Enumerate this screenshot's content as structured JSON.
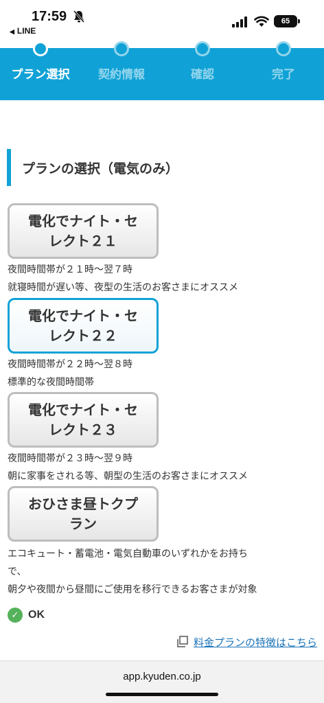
{
  "status_bar": {
    "time": "17:59",
    "back_label": "LINE",
    "battery": "65"
  },
  "progress": {
    "steps": [
      {
        "label": "プラン選択",
        "active": true
      },
      {
        "label": "契約情報",
        "active": false
      },
      {
        "label": "確認",
        "active": false
      },
      {
        "label": "完了",
        "active": false
      }
    ]
  },
  "section": {
    "title": "プランの選択（電気のみ）"
  },
  "plans": [
    {
      "name_line1": "電化でナイト・セ",
      "name_line2": "レクト２１",
      "desc_line1": "夜間時間帯が２１時〜翌７時",
      "desc_line2": "就寝時間が遅い等、夜型の生活のお客さまにオススメ",
      "selected": false
    },
    {
      "name_line1": "電化でナイト・セ",
      "name_line2": "レクト２２",
      "desc_line1": "夜間時間帯が２２時〜翌８時",
      "desc_line2": "標準的な夜間時間帯",
      "selected": true
    },
    {
      "name_line1": "電化でナイト・セ",
      "name_line2": "レクト２３",
      "desc_line1": "夜間時間帯が２３時〜翌９時",
      "desc_line2": "朝に家事をされる等、朝型の生活のお客さまにオススメ",
      "selected": false
    },
    {
      "name_line1": "おひさま昼トクプ",
      "name_line2": "ラン",
      "desc_line1": "エコキュート・蓄電池・電気自動車のいずれかをお持ち",
      "desc_line2": "で、",
      "desc_line3": "朝夕や夜間から昼間にご使用を移行できるお客さまが対象",
      "selected": false
    }
  ],
  "ok": {
    "label": "OK"
  },
  "link": {
    "label": "料金プランの特徴はこちら"
  },
  "browser": {
    "url": "app.kyuden.co.jp"
  },
  "colors": {
    "brand": "#10a2d6",
    "ok_green": "#55b15a",
    "link": "#1a73b8"
  }
}
